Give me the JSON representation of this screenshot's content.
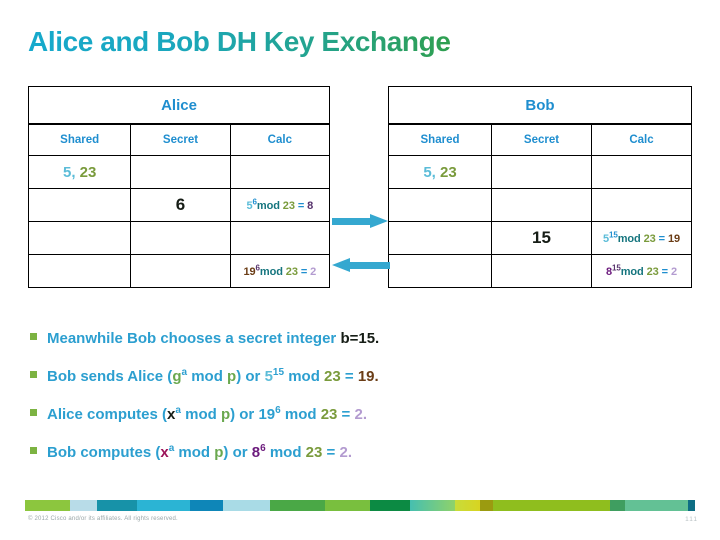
{
  "slide": {
    "title": "Alice and Bob DH Key Exchange"
  },
  "tables": {
    "alice": {
      "name": "Alice",
      "columns": [
        "Shared",
        "Secret",
        "Calc"
      ],
      "rows": [
        {
          "shared_g": "5",
          "shared_sep": ", ",
          "shared_p": "23",
          "secret": "",
          "calc": ""
        },
        {
          "shared": "",
          "secret": "6",
          "calc_base": "5",
          "calc_exp": "6",
          "calc_mod": "mod",
          "calc_p": "23",
          "calc_eq": "=",
          "calc_result": "8"
        },
        {
          "shared": "",
          "secret": "",
          "calc": ""
        },
        {
          "shared": "",
          "secret": "",
          "calc_base": "19",
          "calc_exp": "6",
          "calc_mod": "mod",
          "calc_p": "23",
          "calc_eq": "=",
          "calc_result": "2"
        }
      ]
    },
    "bob": {
      "name": "Bob",
      "columns": [
        "Shared",
        "Secret",
        "Calc"
      ],
      "rows": [
        {
          "shared_g": "5",
          "shared_sep": ", ",
          "shared_p": "23",
          "secret": "",
          "calc": ""
        },
        {
          "shared": "",
          "secret": "",
          "calc": ""
        },
        {
          "shared": "",
          "secret": "15",
          "calc_base": "5",
          "calc_exp": "15",
          "calc_mod": "mod",
          "calc_p": "23",
          "calc_eq": "=",
          "calc_result": "19"
        },
        {
          "shared": "",
          "secret": "",
          "calc_base": "8",
          "calc_exp": "15",
          "calc_mod": "mod",
          "calc_p": "23",
          "calc_eq": "=",
          "calc_result": "2"
        }
      ]
    }
  },
  "arrows": {
    "right": "arrow-right-alice-to-bob",
    "left": "arrow-left-bob-to-alice"
  },
  "bullets": [
    {
      "parts": [
        {
          "text": "Meanwhile Bob chooses a secret integer ",
          "style": "b-teal"
        },
        {
          "text": "b=15",
          "style": "b-dark"
        },
        {
          "text": ".",
          "style": "b-dark"
        }
      ]
    },
    {
      "parts": [
        {
          "text": "Bob sends Alice (",
          "style": "b-teal"
        },
        {
          "text": "g",
          "style": "b-green"
        },
        {
          "text": "a",
          "style": "b-teal",
          "sup": true
        },
        {
          "text": " mod ",
          "style": "b-teal"
        },
        {
          "text": "p",
          "style": "b-green"
        },
        {
          "text": ") or ",
          "style": "b-teal"
        },
        {
          "text": "5",
          "style": "b-lightb"
        },
        {
          "text": "15",
          "style": "b-teal",
          "sup": true
        },
        {
          "text": " mod ",
          "style": "b-teal"
        },
        {
          "text": "23",
          "style": "b-olive"
        },
        {
          "text": " = ",
          "style": "b-teal"
        },
        {
          "text": "19",
          "style": "b-brown"
        },
        {
          "text": ".",
          "style": "b-brown"
        }
      ]
    },
    {
      "parts": [
        {
          "text": "Alice computes (",
          "style": "b-teal"
        },
        {
          "text": "x",
          "style": "b-dark"
        },
        {
          "text": "a",
          "style": "b-teal",
          "sup": true
        },
        {
          "text": " mod ",
          "style": "b-teal"
        },
        {
          "text": "p",
          "style": "b-green"
        },
        {
          "text": ") or ",
          "style": "b-teal"
        },
        {
          "text": "19",
          "style": "b-teal"
        },
        {
          "text": "6",
          "style": "b-teal",
          "sup": true
        },
        {
          "text": " mod ",
          "style": "b-teal"
        },
        {
          "text": "23",
          "style": "b-olive"
        },
        {
          "text": " = ",
          "style": "b-teal"
        },
        {
          "text": "2",
          "style": "b-lilac"
        },
        {
          "text": ".",
          "style": "b-lilac"
        }
      ]
    },
    {
      "parts": [
        {
          "text": "Bob computes (",
          "style": "b-teal"
        },
        {
          "text": "x",
          "style": "b-magenta"
        },
        {
          "text": "a",
          "style": "b-teal",
          "sup": true
        },
        {
          "text": " mod ",
          "style": "b-teal"
        },
        {
          "text": "p",
          "style": "b-green"
        },
        {
          "text": ") or ",
          "style": "b-teal"
        },
        {
          "text": "8",
          "style": "b-purple"
        },
        {
          "text": "6",
          "style": "b-purple",
          "sup": true
        },
        {
          "text": " mod ",
          "style": "b-teal"
        },
        {
          "text": "23",
          "style": "b-olive"
        },
        {
          "text": " = ",
          "style": "b-teal"
        },
        {
          "text": "2",
          "style": "b-lilac"
        },
        {
          "text": ".",
          "style": "b-lilac"
        }
      ]
    }
  ],
  "footer": {
    "copyright": "© 2012 Cisco and/or its affiliates. All rights reserved.",
    "page_number": "111"
  },
  "colors": {
    "title_start": "#16a9cc",
    "title_end": "#2f9f4f",
    "header_blue": "#1f8ecf",
    "arrow_blue": "#35a8d0",
    "bullet_green": "#7cb342",
    "prime_olive": "#7a9b3c",
    "generator_lightblue": "#5bbcd8"
  }
}
